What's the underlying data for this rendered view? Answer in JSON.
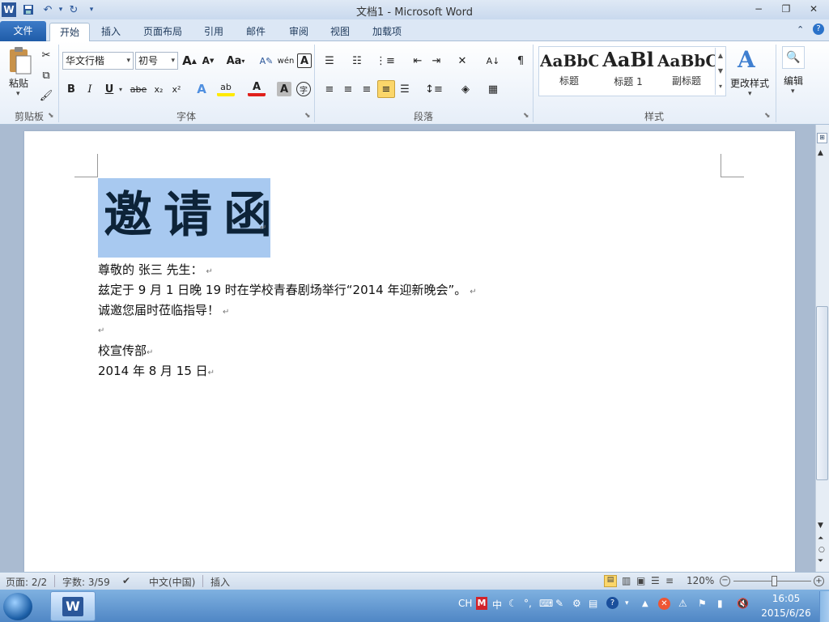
{
  "window": {
    "title": "文档1 - Microsoft Word",
    "controls": {
      "minimize": "−",
      "restore": "❐",
      "close": "✕"
    }
  },
  "quick_access": {
    "app_icon": "W",
    "save": "💾",
    "undo": "↶",
    "redo": "↻",
    "customize": "▾"
  },
  "tabs": [
    "文件",
    "开始",
    "插入",
    "页面布局",
    "引用",
    "邮件",
    "审阅",
    "视图",
    "加载项"
  ],
  "ribbon": {
    "clipboard": {
      "paste_label": "粘贴",
      "group_label": "剪贴板"
    },
    "font": {
      "font_name": "华文行楷",
      "font_size": "初号",
      "grow": "A",
      "shrink": "A",
      "change_case": "Aa",
      "group_label": "字体",
      "bold": "B",
      "italic": "I",
      "underline": "U",
      "strike": "abe",
      "subscript": "x₂",
      "superscript": "x²",
      "text_effect": "A",
      "highlight": "ab",
      "font_color": "A",
      "char_shading": "A",
      "enclose": "字",
      "clear": "A",
      "phonetic": "wén",
      "border": "A"
    },
    "paragraph": {
      "group_label": "段落"
    },
    "styles": {
      "items": [
        {
          "sample": "AaBbC",
          "name": "标题"
        },
        {
          "sample": "AaBl",
          "name": "标题 1"
        },
        {
          "sample": "AaBbC",
          "name": "副标题"
        }
      ],
      "change_styles": "更改样式",
      "group_label": "样式"
    },
    "editing": {
      "label": "编辑"
    }
  },
  "document": {
    "title": "邀请函",
    "paragraphs": [
      "尊敬的  张三  先生：",
      "兹定于 9 月 1 日晚 19 时在学校青春剧场举行“2014 年迎新晚会”。",
      "诚邀您届时莅临指导！",
      "",
      "校宣传部",
      "2014 年 8 月 15 日"
    ],
    "paragraph_mark": "↵"
  },
  "status_bar": {
    "page": "页面: 2/2",
    "words": "字数: 3/59",
    "language": "中文(中国)",
    "mode": "插入",
    "zoom": "120%"
  },
  "taskbar": {
    "ime": "CH",
    "time": "16:05",
    "date": "2015/6/26"
  }
}
